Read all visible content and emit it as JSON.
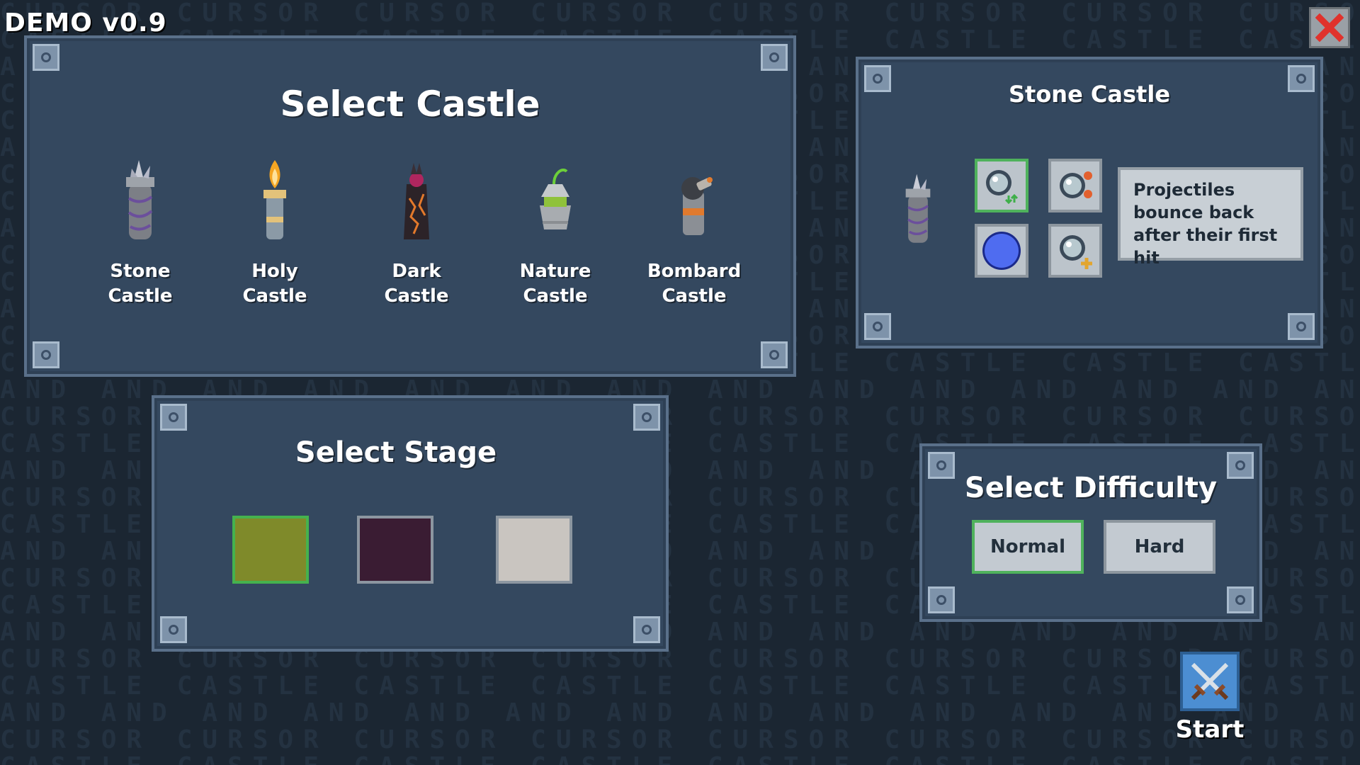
{
  "version_label": "DEMO v0.9",
  "background_watermark": [
    "CURSOR",
    "CASTLE",
    "AND"
  ],
  "castle_panel": {
    "title": "Select Castle",
    "castles": [
      {
        "label": "Stone\nCastle",
        "icon": "stone-castle-icon"
      },
      {
        "label": "Holy\nCastle",
        "icon": "holy-castle-icon"
      },
      {
        "label": "Dark\nCastle",
        "icon": "dark-castle-icon"
      },
      {
        "label": "Nature\nCastle",
        "icon": "nature-castle-icon"
      },
      {
        "label": "Bombard\nCastle",
        "icon": "bombard-castle-icon"
      }
    ]
  },
  "details_panel": {
    "title": "Stone Castle",
    "skills": [
      {
        "icon": "bounce-orb-icon",
        "selected": true
      },
      {
        "icon": "multi-orb-icon",
        "selected": false
      },
      {
        "icon": "blue-orb-icon",
        "selected": false
      },
      {
        "icon": "orb-plus-icon",
        "selected": false
      }
    ],
    "description": "Projectiles bounce back after their first hit"
  },
  "stage_panel": {
    "title": "Select Stage",
    "stages": [
      {
        "color": "#7f8a2a",
        "selected": true
      },
      {
        "color": "#3a1c33",
        "selected": false
      },
      {
        "color": "#c9c5c0",
        "selected": false
      }
    ]
  },
  "difficulty_panel": {
    "title": "Select Difficulty",
    "normal_label": "Normal",
    "hard_label": "Hard",
    "selected": "Normal"
  },
  "start": {
    "label": "Start",
    "icon": "crossed-swords-icon"
  },
  "colors": {
    "background": "#1b2632",
    "panel": "#34485f",
    "selected_border": "#4fb25c",
    "close_red": "#e0322c"
  }
}
